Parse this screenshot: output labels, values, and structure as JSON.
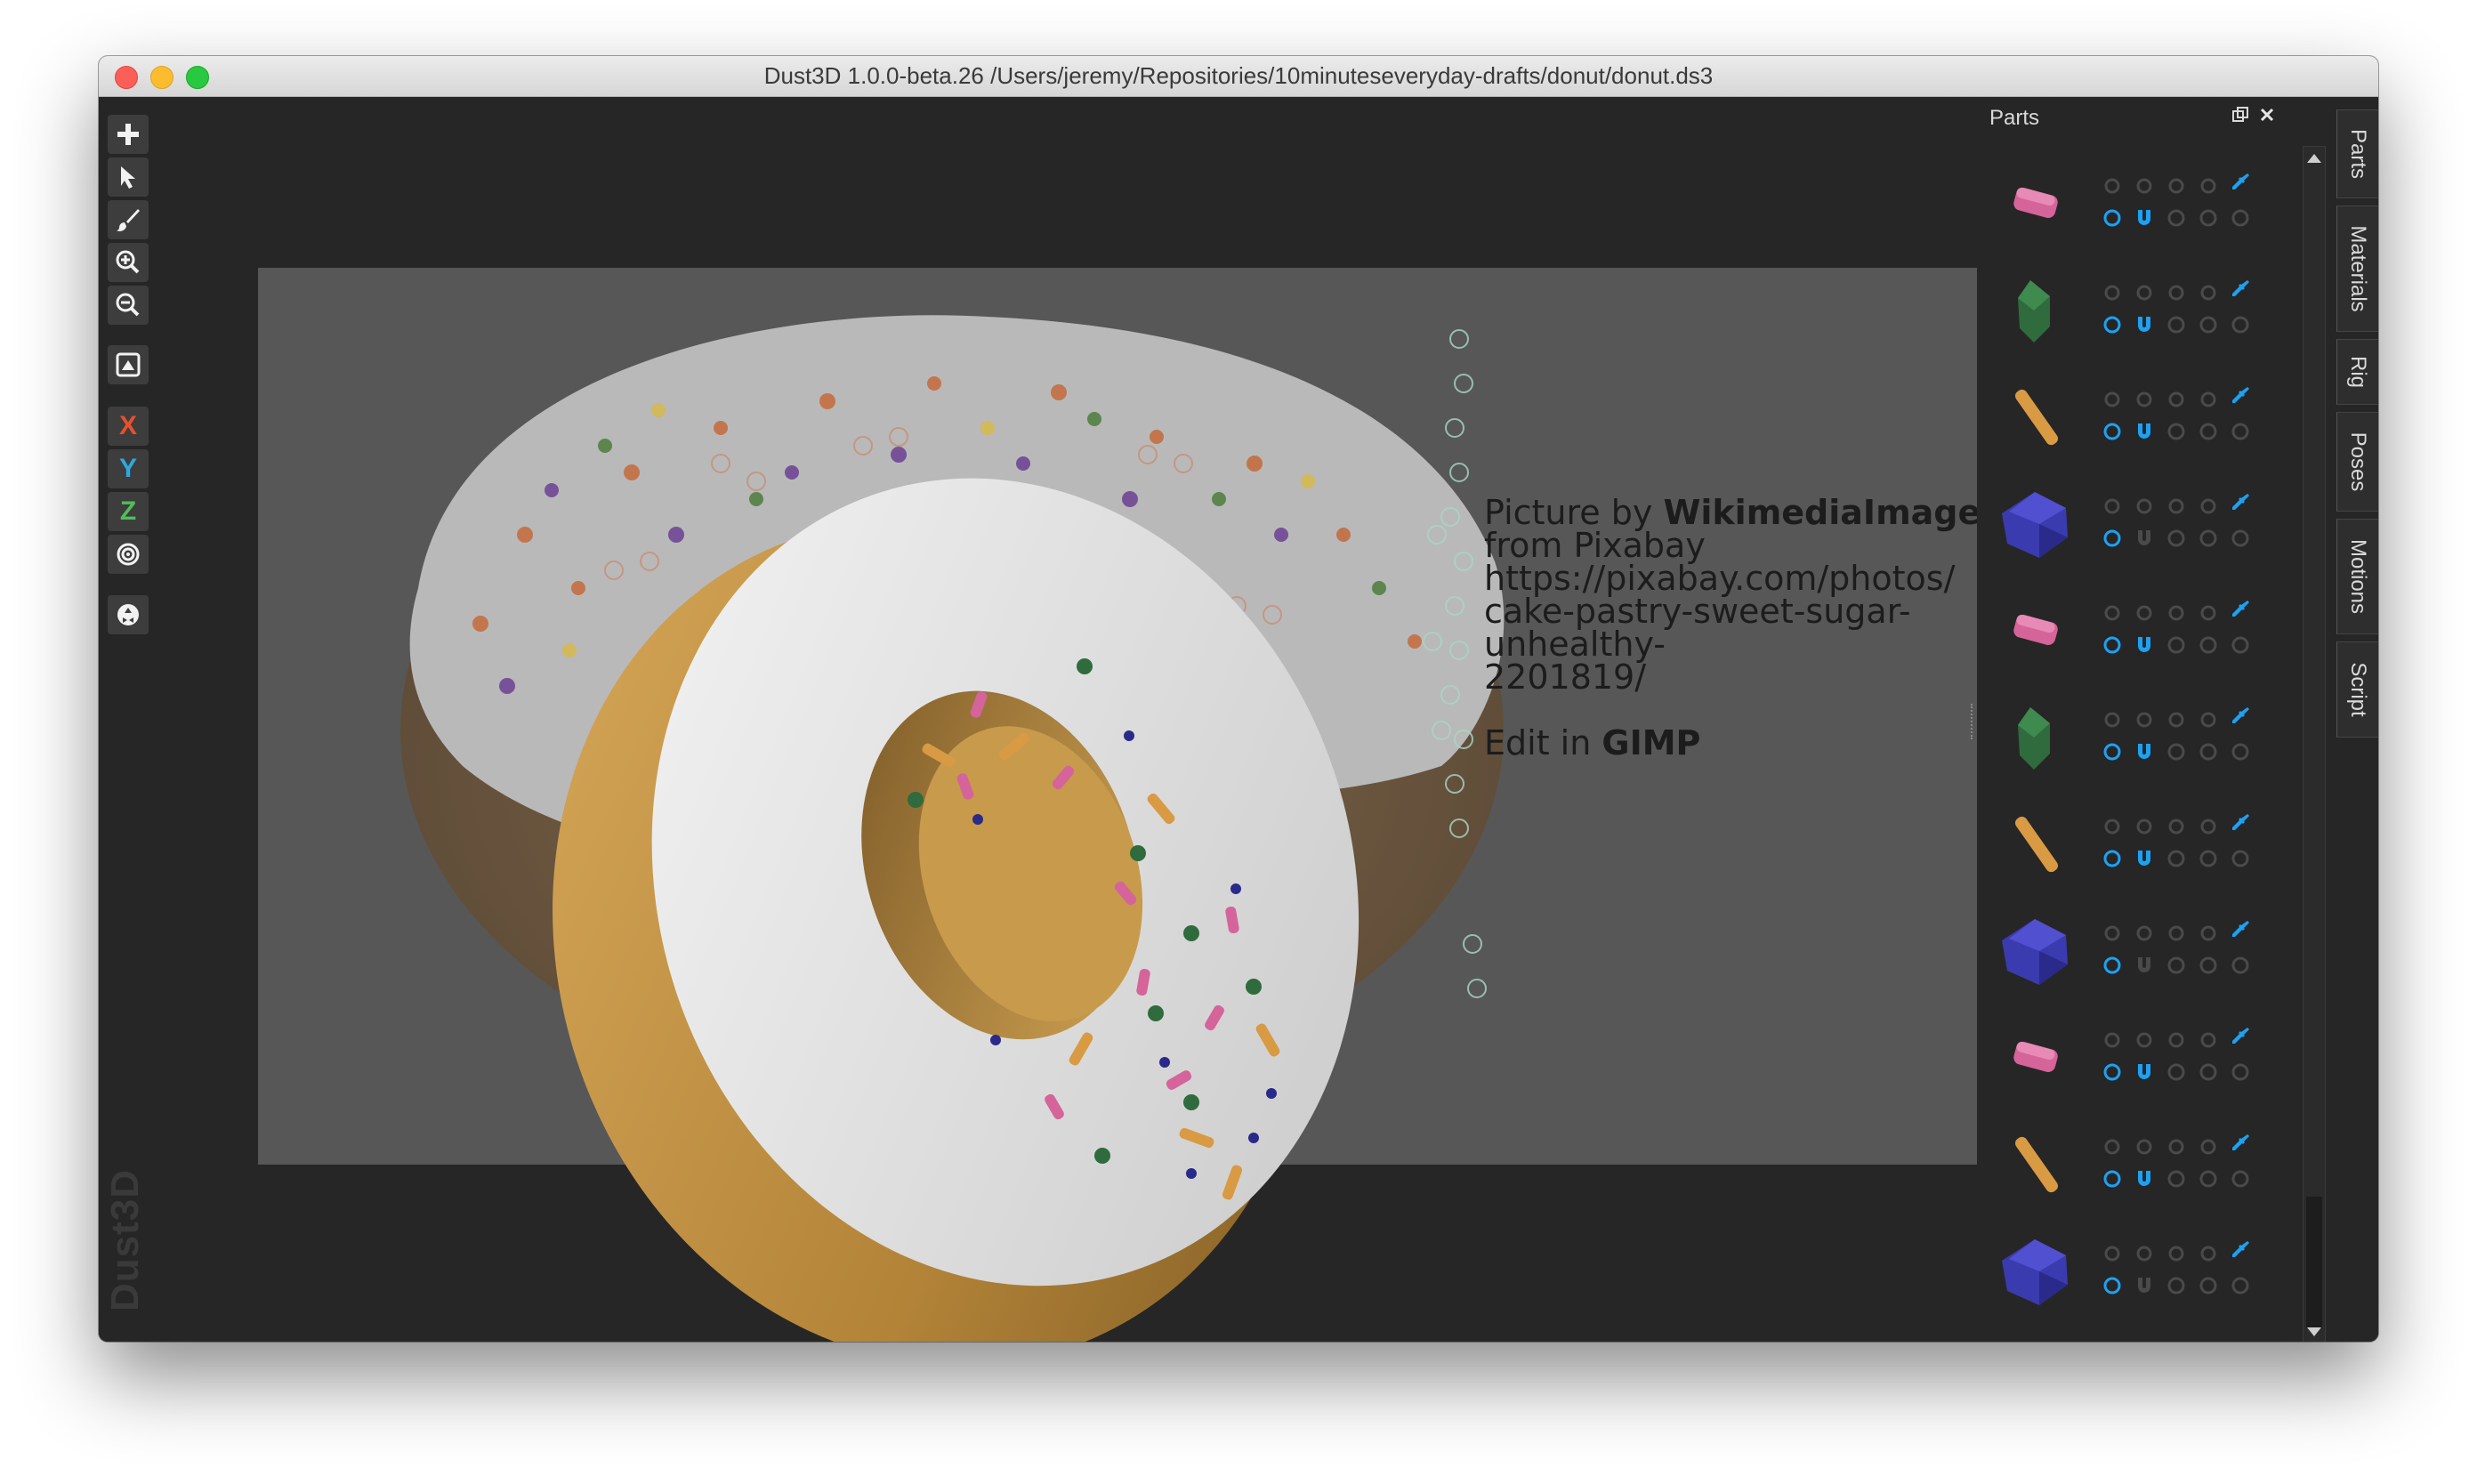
{
  "window": {
    "title": "Dust3D 1.0.0-beta.26 /Users/jeremy/Repositories/10minuteseveryday-drafts/donut/donut.ds3"
  },
  "toolbar": {
    "tools": [
      {
        "name": "add-icon"
      },
      {
        "name": "select-icon"
      },
      {
        "name": "paint-brush-icon"
      },
      {
        "name": "zoom-in-icon"
      },
      {
        "name": "zoom-out-icon"
      },
      {
        "name": "reference-image-icon"
      }
    ],
    "axis_x": "X",
    "axis_y": "Y",
    "axis_z": "Z",
    "axis_colors": {
      "x": "#e8502e",
      "y": "#2fa8e0",
      "z": "#4fbe58"
    },
    "radial_icon": "radial-icon",
    "regenerate_icon": "recycle-icon"
  },
  "watermark": "Dust3D",
  "reference_credit": {
    "line1_prefix": "Picture by ",
    "line1_author": "WikimediaImages",
    "line2": "from Pixabay",
    "line3": "https://pixabay.com/photos/",
    "line4": "cake-pastry-sweet-sugar-",
    "line5": "unhealthy-",
    "line6": "2201819/",
    "line7_prefix": "Edit in ",
    "line7_app": "GIMP"
  },
  "parts_panel": {
    "title": "Parts",
    "accent_color": "#1da1f2",
    "parts": [
      {
        "shape": "pink-sprinkle",
        "color": "#d4649a",
        "mirror": true
      },
      {
        "shape": "green-sprinkle",
        "color": "#2f6b3c",
        "mirror": true
      },
      {
        "shape": "orange-sprinkle",
        "color": "#d99a44",
        "mirror": true
      },
      {
        "shape": "blue-ball",
        "color": "#3b3bb0",
        "mirror": false
      },
      {
        "shape": "pink-sprinkle",
        "color": "#d4649a",
        "mirror": true
      },
      {
        "shape": "green-sprinkle",
        "color": "#2f6b3c",
        "mirror": true
      },
      {
        "shape": "orange-sprinkle",
        "color": "#d99a44",
        "mirror": true
      },
      {
        "shape": "blue-ball",
        "color": "#3b3bb0",
        "mirror": false
      },
      {
        "shape": "pink-sprinkle",
        "color": "#d4649a",
        "mirror": true
      },
      {
        "shape": "orange-sprinkle",
        "color": "#d99a44",
        "mirror": true
      },
      {
        "shape": "blue-ball",
        "color": "#3b3bb0",
        "mirror": false
      }
    ]
  },
  "side_tabs": [
    "Parts",
    "Materials",
    "Rig",
    "Poses",
    "Motions",
    "Script"
  ]
}
